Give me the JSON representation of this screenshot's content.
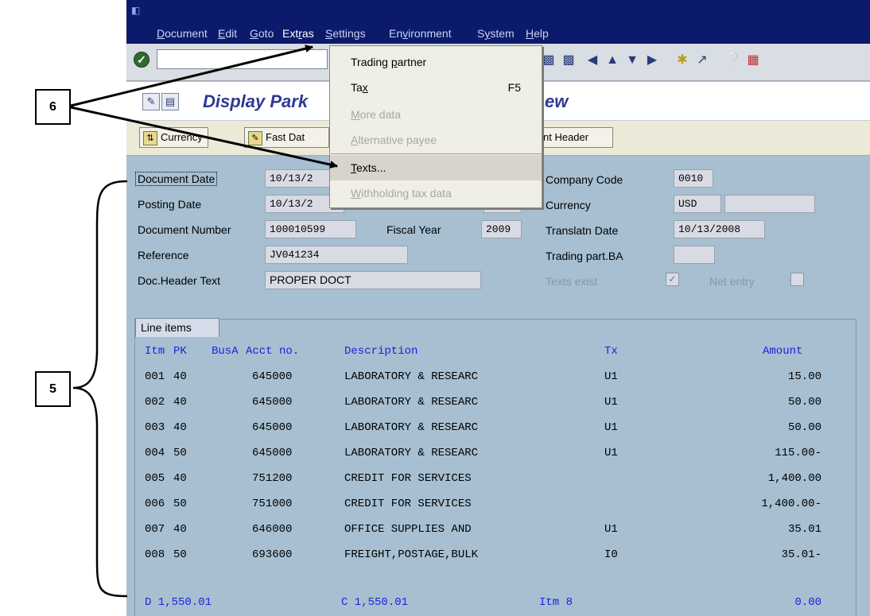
{
  "menubar": {
    "items": [
      {
        "label": "Document",
        "u": "D"
      },
      {
        "label": "Edit",
        "u": "E"
      },
      {
        "label": "Goto",
        "u": "G"
      },
      {
        "label": "Extras",
        "u": "r"
      },
      {
        "label": "Settings",
        "u": "S"
      },
      {
        "label": "Environment",
        "u": "v"
      },
      {
        "label": "System",
        "u": "y"
      },
      {
        "label": "Help",
        "u": "H"
      }
    ]
  },
  "toolbar": {
    "icons": [
      "enter-icon",
      "save-icon",
      "back-icon",
      "exit-icon",
      "cancel-icon",
      "print-icon",
      "find-icon",
      "find-next-icon",
      "first-page-icon",
      "previous-page-icon",
      "next-page-icon",
      "last-page-icon",
      "new-session-icon",
      "shortcut-icon",
      "help-icon",
      "layout-icon"
    ]
  },
  "title": {
    "text_left": "Display Park",
    "text_right": "ew"
  },
  "appbar": {
    "currency": "Currency",
    "fast_data": "Fast Dat",
    "doc_header": "nt Header"
  },
  "header": {
    "document_date": {
      "label": "Document Date",
      "value": "10/13/2"
    },
    "posting_date": {
      "label": "Posting Date",
      "value": "10/13/2"
    },
    "document_number": {
      "label": "Document Number",
      "value": "100010599"
    },
    "fiscal_year": {
      "label": "Fiscal Year",
      "value": "2009"
    },
    "reference": {
      "label": "Reference",
      "value": "JV041234"
    },
    "doc_header_text": {
      "label": "Doc.Header Text",
      "value": "PROPER DOCT"
    },
    "company_code": {
      "label": "Company Code",
      "value": "0010"
    },
    "currency": {
      "label": "Currency",
      "value": "USD",
      "extra": ""
    },
    "translation_date": {
      "label": "Translatn Date",
      "value": "10/13/2008"
    },
    "trading_part_ba": {
      "label": "Trading part.BA",
      "value": ""
    },
    "texts_exist": {
      "label": "Texts exist",
      "checked": true
    },
    "net_entry": {
      "label": "Net entry",
      "checked": false
    }
  },
  "line_items": {
    "tab_label": "Line items",
    "columns": {
      "itm": "Itm",
      "pk": "PK",
      "busa": "BusA",
      "acct": "Acct no.",
      "desc": "Description",
      "tx": "Tx",
      "amount": "Amount"
    },
    "rows": [
      {
        "itm": "001",
        "pk": "40",
        "acct": "645000",
        "desc": "LABORATORY & RESEARC",
        "tx": "U1",
        "amount": "15.00"
      },
      {
        "itm": "002",
        "pk": "40",
        "acct": "645000",
        "desc": "LABORATORY & RESEARC",
        "tx": "U1",
        "amount": "50.00"
      },
      {
        "itm": "003",
        "pk": "40",
        "acct": "645000",
        "desc": "LABORATORY & RESEARC",
        "tx": "U1",
        "amount": "50.00"
      },
      {
        "itm": "004",
        "pk": "50",
        "acct": "645000",
        "desc": "LABORATORY & RESEARC",
        "tx": "U1",
        "amount": "115.00-"
      },
      {
        "itm": "005",
        "pk": "40",
        "acct": "751200",
        "desc": "CREDIT FOR SERVICES",
        "tx": "",
        "amount": "1,400.00"
      },
      {
        "itm": "006",
        "pk": "50",
        "acct": "751000",
        "desc": "CREDIT FOR SERVICES",
        "tx": "",
        "amount": "1,400.00-"
      },
      {
        "itm": "007",
        "pk": "40",
        "acct": "646000",
        "desc": "OFFICE SUPPLIES AND",
        "tx": "U1",
        "amount": "35.01"
      },
      {
        "itm": "008",
        "pk": "50",
        "acct": "693600",
        "desc": "FREIGHT,POSTAGE,BULK",
        "tx": "I0",
        "amount": "35.01-"
      }
    ],
    "totals": {
      "debit": "D 1,550.01",
      "credit": "C 1,550.01",
      "items": "Itm 8",
      "balance": "0.00"
    }
  },
  "dropdown": {
    "items": [
      {
        "pre": "Trading ",
        "u": "p",
        "post": "artner",
        "shortcut": "",
        "enabled": true
      },
      {
        "pre": "Ta",
        "u": "x",
        "post": "",
        "shortcut": "F5",
        "enabled": true
      },
      {
        "pre": "",
        "u": "M",
        "post": "ore data",
        "shortcut": "",
        "enabled": false
      },
      {
        "pre": "",
        "u": "A",
        "post": "lternative payee",
        "shortcut": "",
        "enabled": false
      },
      {
        "pre": "",
        "u": "T",
        "post": "exts...",
        "shortcut": "",
        "enabled": true
      },
      {
        "pre": "",
        "u": "W",
        "post": "ithholding tax data",
        "shortcut": "",
        "enabled": false
      }
    ]
  },
  "callouts": {
    "six": "6",
    "five": "5"
  }
}
